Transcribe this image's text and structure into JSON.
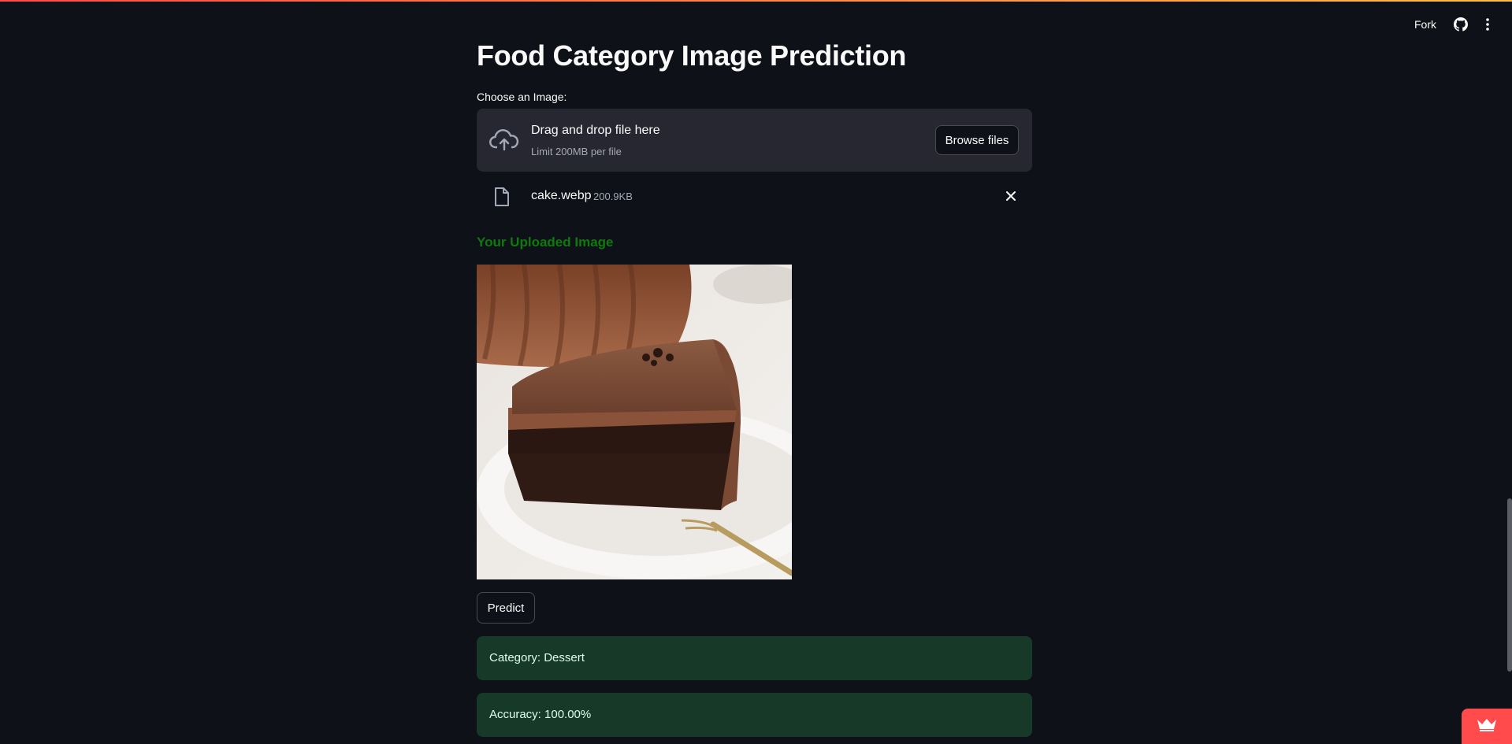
{
  "toolbar": {
    "fork_label": "Fork"
  },
  "page": {
    "title": "Food Category Image Prediction"
  },
  "uploader": {
    "label": "Choose an Image:",
    "drag_text": "Drag and drop file here",
    "limit_text": "Limit 200MB per file",
    "browse_label": "Browse files"
  },
  "uploaded_file": {
    "name": "cake.webp",
    "size": "200.9KB"
  },
  "subheader": "Your Uploaded Image",
  "predict_label": "Predict",
  "results": {
    "category": "Category: Dessert",
    "accuracy": "Accuracy: 100.00%"
  },
  "colors": {
    "background": "#0e1117",
    "dropzone": "#262730",
    "success_bg": "#173928",
    "subheader": "#0e7a0d",
    "accent": "#ff4b4b"
  },
  "icons": {
    "toolbar": [
      "github-icon",
      "more-vertical-icon"
    ],
    "uploader": "cloud-upload-icon",
    "file": "file-icon",
    "remove": "close-icon",
    "badge": "crown-icon"
  }
}
